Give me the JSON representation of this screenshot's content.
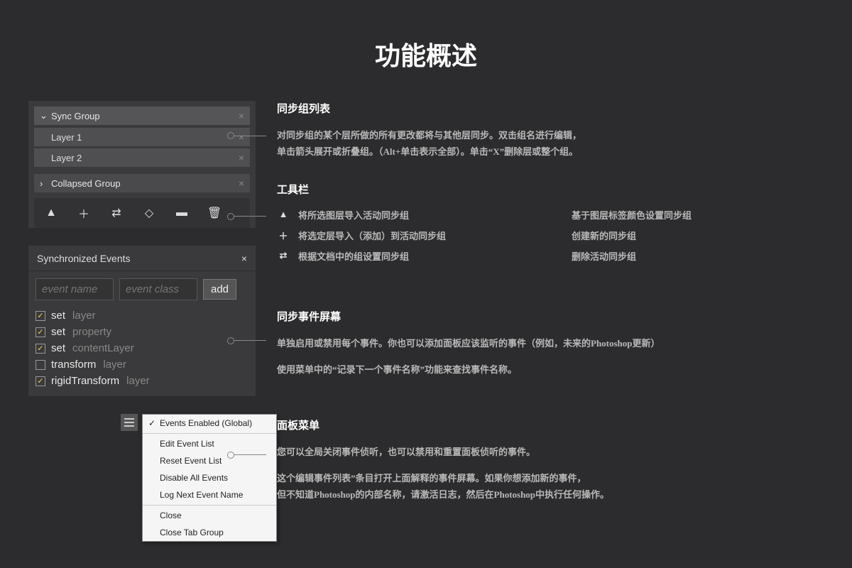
{
  "title": "功能概述",
  "syncPanel": {
    "group1": {
      "name": "Sync Group",
      "layers": [
        "Layer 1",
        "Layer 2"
      ]
    },
    "group2": {
      "name": "Collapsed Group"
    }
  },
  "eventsPanel": {
    "title": "Synchronized Events",
    "namePlaceholder": "event name",
    "classPlaceholder": "event class",
    "addLabel": "add",
    "items": [
      {
        "checked": true,
        "name": "set",
        "cls": "layer"
      },
      {
        "checked": true,
        "name": "set",
        "cls": "property"
      },
      {
        "checked": true,
        "name": "set",
        "cls": "contentLayer"
      },
      {
        "checked": false,
        "name": "transform",
        "cls": "layer"
      },
      {
        "checked": true,
        "name": "rigidTransform",
        "cls": "layer"
      }
    ]
  },
  "menu": {
    "items": [
      "Events Enabled (Global)",
      "Edit Event List",
      "Reset Event List",
      "Disable All Events",
      "Log Next Event Name",
      "Close",
      "Close Tab Group"
    ]
  },
  "desc": {
    "b1": {
      "h": "同步组列表",
      "p1": "对同步组的某个层所做的所有更改都将与其他层同步。双击组名进行编辑，",
      "p2": "单击箭头展开或折叠组。（Alt+单击表示全部）。单击“X”删除层或整个组。"
    },
    "b2": {
      "h": "工具栏",
      "left": [
        "将所选图层导入活动同步组",
        "将选定层导入（添加）到活动同步组",
        "根据文档中的组设置同步组"
      ],
      "right": [
        "基于图层标签颜色设置同步组",
        "创建新的同步组",
        "删除活动同步组"
      ]
    },
    "b3": {
      "h": "同步事件屏幕",
      "p1": "单独启用或禁用每个事件。你也可以添加面板应该监听的事件（例如，未来的Photoshop更新）",
      "p2": "使用菜单中的“记录下一个事件名称”功能来查找事件名称。"
    },
    "b4": {
      "h": "面板菜单",
      "p1": "您可以全局关闭事件侦听，也可以禁用和重置面板侦听的事件。",
      "p2": "这个编辑事件列表”条目打开上面解释的事件屏幕。如果你想添加新的事件，",
      "p3": "但不知道Photoshop的内部名称，请激活日志，然后在Photoshop中执行任何操作。"
    }
  }
}
